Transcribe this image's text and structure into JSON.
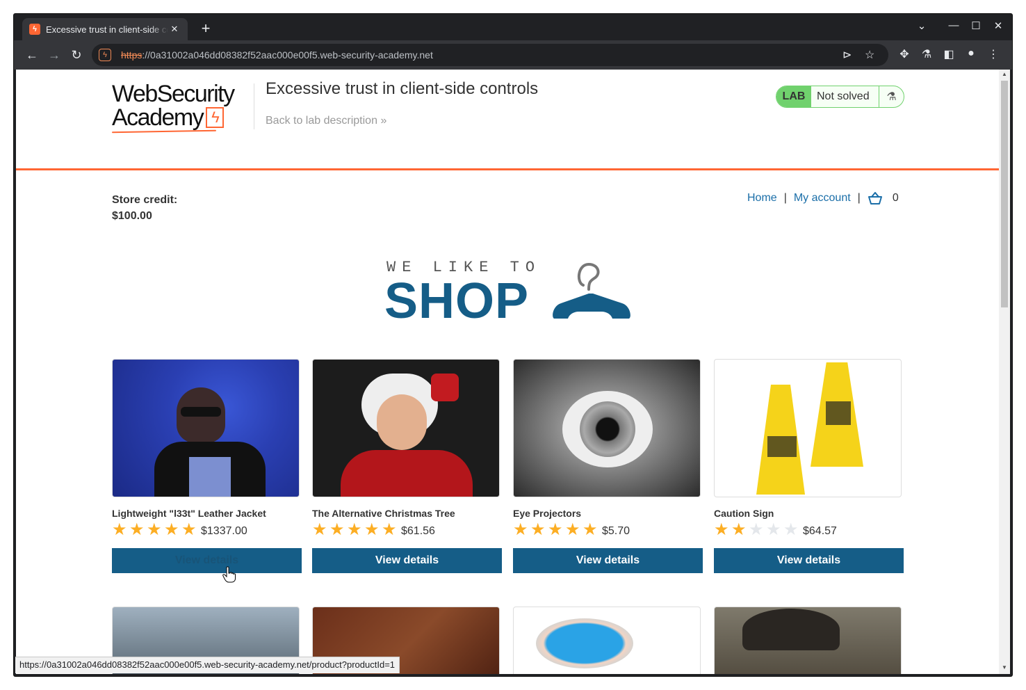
{
  "browser": {
    "tab_title": "Excessive trust in client-side controls",
    "new_tab_label": "+",
    "tab_close": "✕",
    "url_scheme": "https",
    "url_rest": "://0a31002a046dd08382f52aac000e00f5.web-security-academy.net",
    "status_url": "https://0a31002a046dd08382f52aac000e00f5.web-security-academy.net/product?productId=1"
  },
  "header": {
    "logo_line1": "WebSecurity",
    "logo_line2": "Academy",
    "lab_title": "Excessive trust in client-side controls",
    "back_link": "Back to lab description",
    "lab_badge": "LAB",
    "lab_status": "Not solved"
  },
  "store": {
    "credit_label": "Store credit:",
    "credit_value": "$100.00"
  },
  "nav": {
    "home": "Home",
    "my_account": "My account",
    "separator": "|",
    "cart_count": "0"
  },
  "hero": {
    "tagline": "WE LIKE TO",
    "word": "SHOP"
  },
  "products": [
    {
      "name": "Lightweight \"l33t\" Leather Jacket",
      "price": "$1337.00",
      "rating": 5,
      "button": "View details",
      "image": "person-with-headphones"
    },
    {
      "name": "The Alternative Christmas Tree",
      "price": "$61.56",
      "rating": 5,
      "button": "View details",
      "image": "santa-with-lights"
    },
    {
      "name": "Eye Projectors",
      "price": "$5.70",
      "rating": 5,
      "button": "View details",
      "image": "eye-closeup"
    },
    {
      "name": "Caution Sign",
      "price": "$64.57",
      "rating": 2,
      "button": "View details",
      "image": "yellow-caution-signs"
    }
  ],
  "colors": {
    "accent_orange": "#ff6633",
    "brand_blue": "#155d87",
    "link_blue": "#1a6ea8",
    "lab_green": "#70d16d",
    "star_gold": "#fcae24"
  }
}
